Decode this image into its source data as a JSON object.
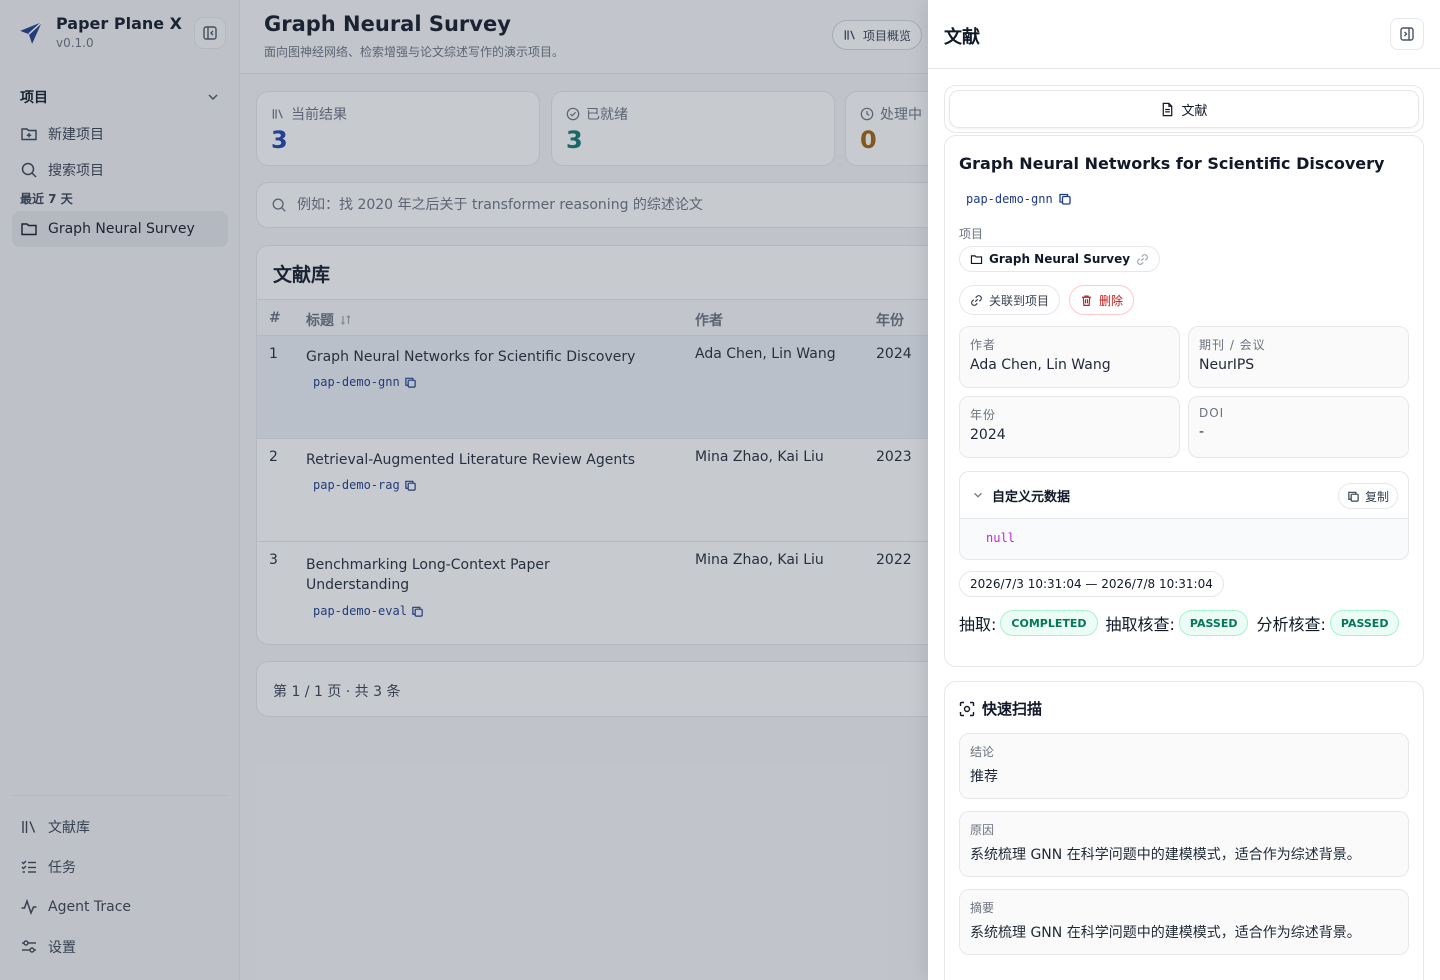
{
  "app": {
    "name": "Paper Plane X",
    "version": "v0.1.0"
  },
  "sidebar": {
    "group_label": "项目",
    "new_project": "新建项目",
    "search_project": "搜索项目",
    "recent_label": "最近 7 天",
    "recent_item": "Graph Neural Survey",
    "bottom": {
      "library": "文献库",
      "tasks": "任务",
      "trace": "Agent Trace",
      "settings": "设置"
    }
  },
  "header": {
    "title": "Graph Neural Survey",
    "subtitle": "面向图神经网络、检索增强与论文综述写作的演示项目。",
    "overview_btn": "项目概览"
  },
  "stats": [
    {
      "label": "当前结果",
      "value": "3",
      "color": "#1e40af"
    },
    {
      "label": "已就绪",
      "value": "3",
      "color": "#0f766e"
    },
    {
      "label": "处理中",
      "value": "0",
      "color": "#a16207"
    }
  ],
  "search": {
    "placeholder": "例如：找 2020 年之后关于 transformer reasoning 的综述论文"
  },
  "library": {
    "title": "文献库",
    "columns": {
      "num": "#",
      "title": "标题",
      "authors": "作者",
      "year": "年份"
    },
    "rows": [
      {
        "num": "1",
        "title": "Graph Neural Networks for Scientific Discovery",
        "id": "pap-demo-gnn",
        "authors": "Ada Chen, Lin Wang",
        "year": "2024"
      },
      {
        "num": "2",
        "title": "Retrieval-Augmented Literature Review Agents",
        "id": "pap-demo-rag",
        "authors": "Mina Zhao, Kai Liu",
        "year": "2023"
      },
      {
        "num": "3",
        "title": "Benchmarking Long-Context Paper Understanding",
        "id": "pap-demo-eval",
        "authors": "Mina Zhao, Kai Liu",
        "year": "2022"
      }
    ],
    "pager": "第 1 / 1 页 · 共 3 条"
  },
  "drawer": {
    "title": "文献",
    "tab": "文献",
    "paper_title": "Graph Neural Networks for Scientific Discovery",
    "paper_id": "pap-demo-gnn",
    "project_label": "项目",
    "project_name": "Graph Neural Survey",
    "link_btn": "关联到项目",
    "delete_btn": "删除",
    "fields": {
      "authors_label": "作者",
      "authors": "Ada Chen, Lin Wang",
      "venue_label": "期刊 / 会议",
      "venue": "NeurIPS",
      "year_label": "年份",
      "year": "2024",
      "doi_label": "DOI",
      "doi": "-"
    },
    "meta": {
      "title": "自定义元数据",
      "copy": "复制",
      "value": "null"
    },
    "time_range": "2026/7/3 10:31:04 — 2026/7/8 10:31:04",
    "status": {
      "extract_label": "抽取:",
      "extract": "COMPLETED",
      "check_label": "抽取核查:",
      "check": "PASSED",
      "analysis_label": "分析核查:",
      "analysis": "PASSED"
    },
    "scan": {
      "title": "快速扫描",
      "conclusion_label": "结论",
      "conclusion": "推荐",
      "reason_label": "原因",
      "reason": "系统梳理 GNN 在科学问题中的建模模式，适合作为综述背景。",
      "summary_label": "摘要",
      "summary": "系统梳理 GNN 在科学问题中的建模模式，适合作为综述背景。"
    }
  }
}
